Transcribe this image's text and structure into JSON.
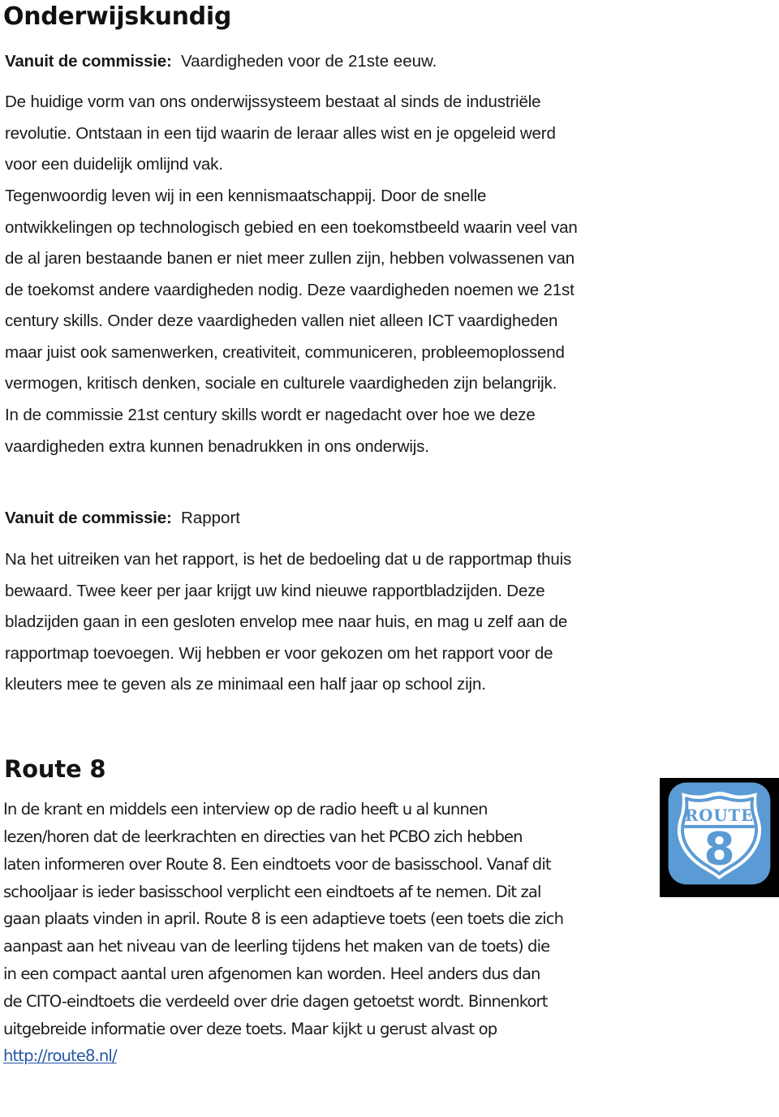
{
  "document": {
    "title": "Onderwijskundig",
    "background_color": "#ffffff",
    "text_color": "#1a1a1a",
    "link_color": "#2455a4",
    "accent_color": "#5b9bd5"
  },
  "sections": {
    "onderwijskundig": {
      "heading": "Onderwijskundig",
      "subheading_lead": "Vanuit de commissie:",
      "subheading_rest": "Vaardigheden voor de 21ste eeuw.",
      "paragraph_lines": [
        "De huidige vorm van ons onderwijssysteem bestaat al sinds de industriële",
        "revolutie. Ontstaan in een tijd waarin de leraar alles wist en je opgeleid werd",
        "voor een duidelijk omlijnd vak.",
        "Tegenwoordig leven wij in een kennismaatschappij. Door de snelle",
        "ontwikkelingen op technologisch gebied en een toekomstbeeld waarin veel van",
        "de al jaren bestaande banen er niet meer zullen zijn, hebben volwassenen van",
        "de toekomst andere vaardigheden nodig. Deze vaardigheden noemen we 21st",
        "century skills. Onder deze vaardigheden vallen niet alleen ICT vaardigheden",
        "maar juist ook samenwerken, creativiteit, communiceren, probleemoplossend",
        "vermogen, kritisch denken, sociale en culturele vaardigheden zijn belangrijk.",
        "In de commissie 21st century skills wordt er nagedacht over hoe we deze",
        "vaardigheden extra kunnen benadrukken in ons onderwijs."
      ]
    },
    "rapport": {
      "subheading_lead": "Vanuit de commissie:",
      "subheading_rest": "Rapport",
      "paragraph_lines": [
        "Na het uitreiken van het rapport, is het de bedoeling dat u de rapportmap thuis",
        "bewaard. Twee keer per jaar krijgt uw kind nieuwe rapportbladzijden. Deze",
        "bladzijden gaan in een gesloten envelop mee naar huis, en mag u zelf aan de",
        "rapportmap toevoegen. Wij hebben er voor gekozen om het rapport voor de",
        "kleuters mee te geven als ze minimaal een half jaar op school zijn."
      ]
    },
    "route8": {
      "heading": "Route 8",
      "paragraph_lines": [
        "In de krant en middels een interview op de radio heeft u al kunnen",
        "lezen/horen dat de leerkrachten en directies van het PCBO zich hebben",
        "laten informeren over Route 8. Een eindtoets voor de basisschool. Vanaf dit",
        "schooljaar is ieder basisschool verplicht een eindtoets af te nemen. Dit zal",
        "gaan plaats vinden in april. Route 8 is een adaptieve toets (een toets die zich",
        "aanpast aan het niveau van de leerling tijdens het maken van de toets) die",
        "in een compact aantal uren afgenomen kan worden. Heel anders dus dan",
        "de CITO-eindtoets die verdeeld over drie dagen getoetst wordt. Binnenkort",
        "uitgebreide informatie over deze toets. Maar kijkt u gerust alvast op"
      ],
      "link_text": "http://route8.nl/",
      "logo": {
        "icon": "route-shield-icon",
        "banner_text": "ROUTE",
        "number_text": "8",
        "shield_color": "#5b9bd5",
        "background_color": "#000000",
        "face_color": "#ffffff"
      }
    }
  }
}
